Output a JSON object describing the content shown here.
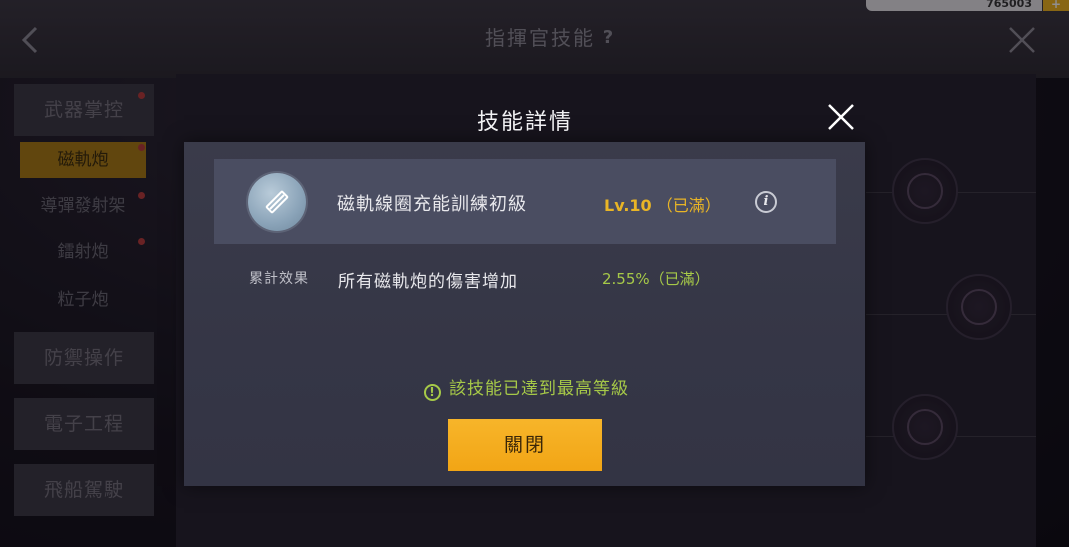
{
  "header": {
    "title": "指揮官技能",
    "currency_amount": "765003"
  },
  "sidebar": {
    "categories": [
      {
        "label": "武器掌控"
      },
      {
        "label": "防禦操作"
      },
      {
        "label": "電子工程"
      },
      {
        "label": "飛船駕駛"
      }
    ],
    "subitems": [
      {
        "label": "磁軌炮",
        "active": true
      },
      {
        "label": "導彈發射架"
      },
      {
        "label": "鐳射炮"
      },
      {
        "label": "粒子炮"
      }
    ]
  },
  "modal": {
    "title": "技能詳情",
    "skill": {
      "name": "磁軌線圈充能訓練初級",
      "level": "Lv.10",
      "level_note": "（已滿）"
    },
    "effect": {
      "label": "累計效果",
      "text": "所有磁軌炮的傷害增加",
      "value": "2.55%（已滿）"
    },
    "notice": "該技能已達到最高等級",
    "close_label": "關閉"
  },
  "colors": {
    "accent_gold": "#f2a515",
    "level_gold": "#e9b526",
    "effect_green": "#a6c948",
    "modal_bg": "#363746"
  }
}
